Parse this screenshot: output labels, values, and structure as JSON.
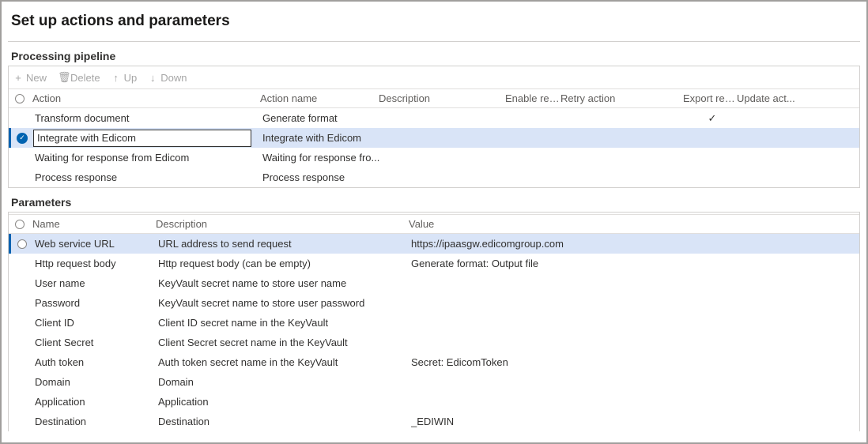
{
  "title": "Set up actions and parameters",
  "pipeline": {
    "title": "Processing pipeline",
    "toolbar": {
      "new": "New",
      "delete": "Delete",
      "up": "Up",
      "down": "Down"
    },
    "headers": {
      "action": "Action",
      "action_name": "Action name",
      "description": "Description",
      "enable_retry": "Enable retry",
      "retry_action": "Retry action",
      "export_result": "Export result",
      "update_act": "Update act..."
    },
    "rows": [
      {
        "action": "Transform document",
        "action_name": "Generate format",
        "export": true,
        "selected": false
      },
      {
        "action": "Integrate with Edicom",
        "action_name": "Integrate with Edicom",
        "export": false,
        "selected": true,
        "editing": true
      },
      {
        "action": "Waiting for response from Edicom",
        "action_name": "Waiting for response fro...",
        "export": false,
        "selected": false
      },
      {
        "action": "Process response",
        "action_name": "Process response",
        "export": false,
        "selected": false
      }
    ]
  },
  "params": {
    "title": "Parameters",
    "headers": {
      "name": "Name",
      "description": "Description",
      "value": "Value"
    },
    "rows": [
      {
        "name": "Web service URL",
        "description": "URL address to send request",
        "value": "https://ipaasgw.edicomgroup.com",
        "selected": true
      },
      {
        "name": "Http request body",
        "description": "Http request body (can be empty)",
        "value": "Generate format: Output file",
        "selected": false
      },
      {
        "name": "User name",
        "description": "KeyVault secret name to store user name",
        "value": "",
        "selected": false
      },
      {
        "name": "Password",
        "description": "KeyVault secret name to store user password",
        "value": "",
        "selected": false
      },
      {
        "name": "Client ID",
        "description": "Client ID secret name in the KeyVault",
        "value": "",
        "selected": false
      },
      {
        "name": "Client Secret",
        "description": "Client Secret secret name in the KeyVault",
        "value": "",
        "selected": false
      },
      {
        "name": "Auth token",
        "description": "Auth token secret name in the KeyVault",
        "value": "Secret:  EdicomToken",
        "selected": false
      },
      {
        "name": "Domain",
        "description": "Domain",
        "value": "",
        "selected": false
      },
      {
        "name": "Application",
        "description": "Application",
        "value": "",
        "selected": false
      },
      {
        "name": "Destination",
        "description": "Destination",
        "value": "_EDIWIN",
        "selected": false
      }
    ]
  }
}
